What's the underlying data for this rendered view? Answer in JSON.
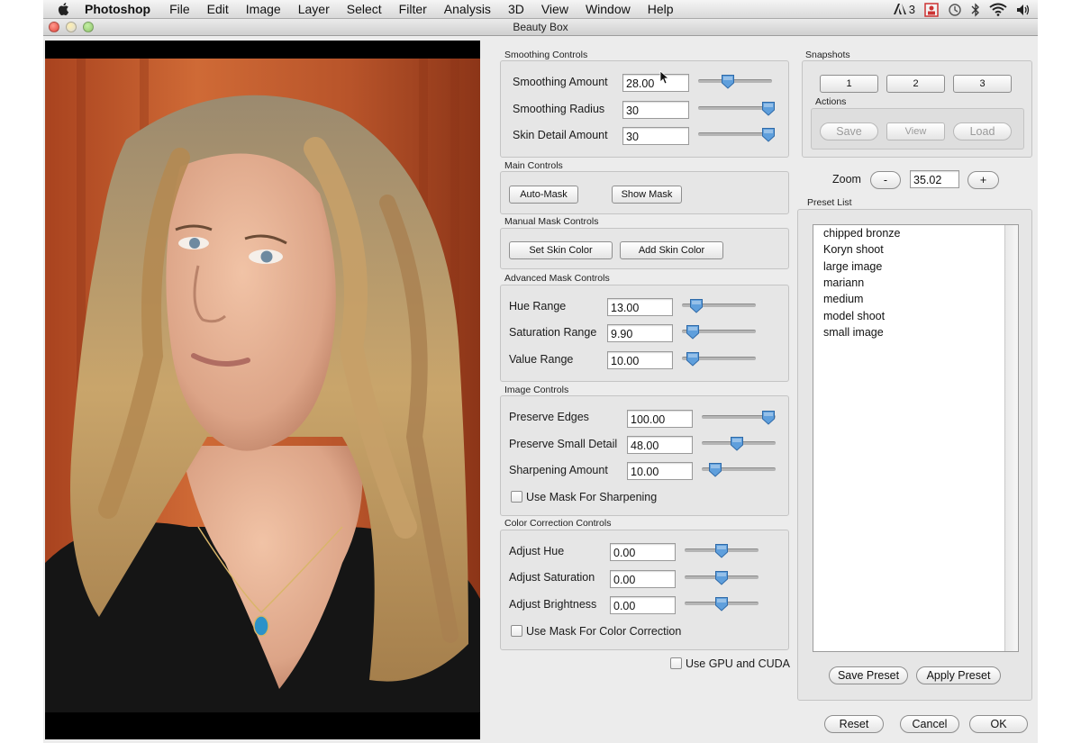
{
  "menubar": {
    "app": "Photoshop",
    "items": [
      "File",
      "Edit",
      "Image",
      "Layer",
      "Select",
      "Filter",
      "Analysis",
      "3D",
      "View",
      "Window",
      "Help"
    ],
    "status_adobe": "3"
  },
  "window": {
    "title": "Beauty Box"
  },
  "smoothing": {
    "label": "Smoothing Controls",
    "amount_label": "Smoothing Amount",
    "amount_value": "28.00",
    "amount_level": 0.4,
    "radius_label": "Smoothing Radius",
    "radius_value": "30",
    "radius_level": 0.95,
    "detail_label": "Skin Detail Amount",
    "detail_value": "30",
    "detail_level": 0.95
  },
  "main_controls": {
    "label": "Main Controls",
    "auto_mask": "Auto-Mask",
    "show_mask": "Show Mask"
  },
  "manual_mask": {
    "label": "Manual Mask Controls",
    "set_skin": "Set Skin Color",
    "add_skin": "Add Skin Color"
  },
  "advanced_mask": {
    "label": "Advanced Mask Controls",
    "hue_label": "Hue Range",
    "hue_value": "13.00",
    "hue_level": 0.2,
    "sat_label": "Saturation Range",
    "sat_value": "9.90",
    "sat_level": 0.15,
    "val_label": "Value Range",
    "val_value": "10.00",
    "val_level": 0.15
  },
  "image_controls": {
    "label": "Image Controls",
    "edges_label": "Preserve Edges",
    "edges_value": "100.00",
    "edges_level": 0.9,
    "small_label": "Preserve Small Detail",
    "small_value": "48.00",
    "small_level": 0.48,
    "sharp_label": "Sharpening Amount",
    "sharp_value": "10.00",
    "sharp_level": 0.18,
    "mask_sharp": "Use Mask For Sharpening"
  },
  "color_correction": {
    "label": "Color Correction Controls",
    "hue_label": "Adjust Hue",
    "hue_value": "0.00",
    "hue_level": 0.5,
    "sat_label": "Adjust Saturation",
    "sat_value": "0.00",
    "sat_level": 0.5,
    "bri_label": "Adjust Brightness",
    "bri_value": "0.00",
    "bri_level": 0.5,
    "mask_color": "Use Mask For Color Correction"
  },
  "gpu": "Use GPU and CUDA",
  "snapshots": {
    "label": "Snapshots",
    "s1": "1",
    "s2": "2",
    "s3": "3",
    "actions_label": "Actions",
    "save": "Save",
    "view": "View",
    "load": "Load"
  },
  "zoom": {
    "label": "Zoom",
    "minus": "-",
    "value": "35.02",
    "plus": "+"
  },
  "presets": {
    "label": "Preset List",
    "items": [
      "chipped bronze",
      "Koryn shoot",
      "large image",
      "mariann",
      "medium",
      "model shoot",
      "small image"
    ],
    "save": "Save Preset",
    "apply": "Apply Preset"
  },
  "footer": {
    "reset": "Reset",
    "cancel": "Cancel",
    "ok": "OK"
  },
  "colors": {
    "knob": "#5f9fdc",
    "backdrop": "#c45a2c",
    "hair": "#c9a56b"
  }
}
